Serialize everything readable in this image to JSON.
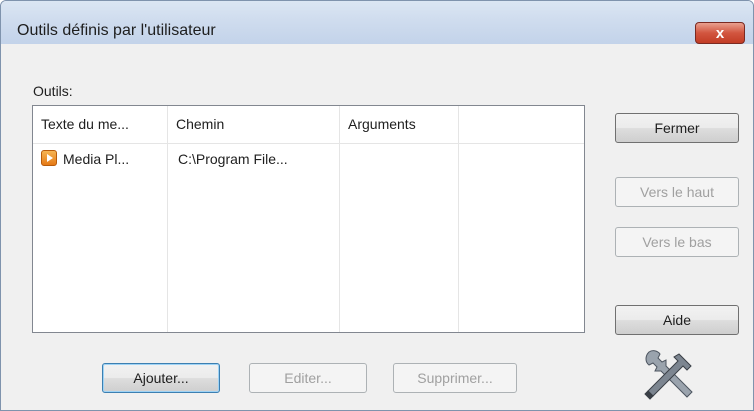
{
  "window": {
    "title": "Outils définis par l'utilisateur",
    "close_label": "x"
  },
  "outils_label": "Outils:",
  "list": {
    "columns": [
      "Texte du me...",
      "Chemin",
      "Arguments"
    ],
    "rows": [
      {
        "icon": "media-player-icon",
        "text": "Media Pl...",
        "path": "C:\\Program File...",
        "arguments": ""
      }
    ]
  },
  "buttons": {
    "fermer": "Fermer",
    "vers_le_haut": "Vers le haut",
    "vers_le_bas": "Vers le bas",
    "aide": "Aide",
    "ajouter": "Ajouter...",
    "editer": "Editer...",
    "supprimer": "Supprimer..."
  },
  "icons": {
    "tools": "hammer-wrench-icon"
  }
}
